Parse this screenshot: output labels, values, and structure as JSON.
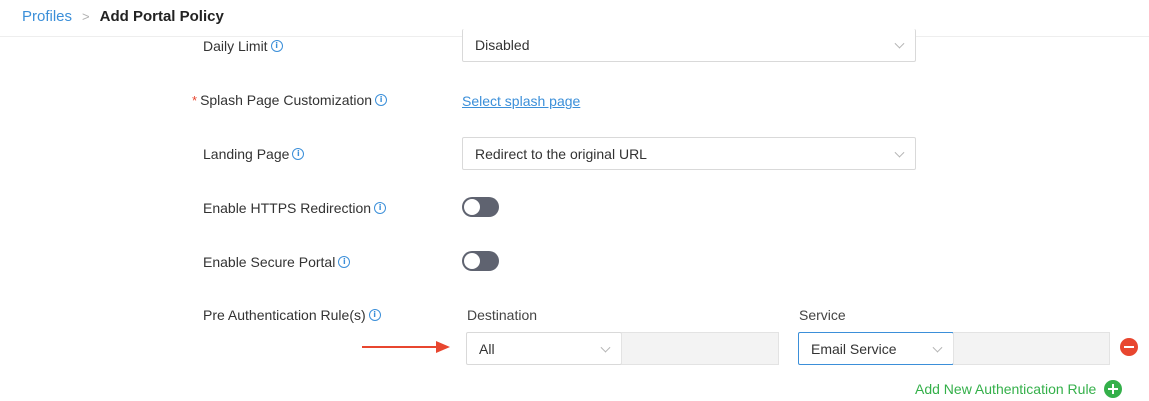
{
  "breadcrumb": {
    "parent": "Profiles",
    "current": "Add Portal Policy"
  },
  "fields": {
    "daily_limit": {
      "label": "Daily Limit",
      "value": "Disabled"
    },
    "splash_page": {
      "label": "Splash Page Customization",
      "required_mark": "*",
      "link": "Select splash page"
    },
    "landing_page": {
      "label": "Landing Page",
      "value": "Redirect to the original URL"
    },
    "https_redirection": {
      "label": "Enable HTTPS Redirection",
      "enabled": false
    },
    "secure_portal": {
      "label": "Enable Secure Portal",
      "enabled": false
    }
  },
  "pre_auth": {
    "label": "Pre Authentication Rule(s)",
    "destination_header": "Destination",
    "service_header": "Service",
    "rules": [
      {
        "destination": "All",
        "service": "Email Service"
      }
    ],
    "add_label": "Add New Authentication Rule"
  },
  "icons": {
    "info": "info-icon",
    "remove": "minus-circle-icon",
    "add": "plus-circle-icon",
    "chevron": "chevron-down-icon",
    "arrow": "arrow-right-icon"
  },
  "colors": {
    "link": "#3b8fd9",
    "toggle_off": "#5f6370",
    "danger": "#e8462f",
    "success": "#34b04a",
    "arrow": "#e8462f"
  }
}
